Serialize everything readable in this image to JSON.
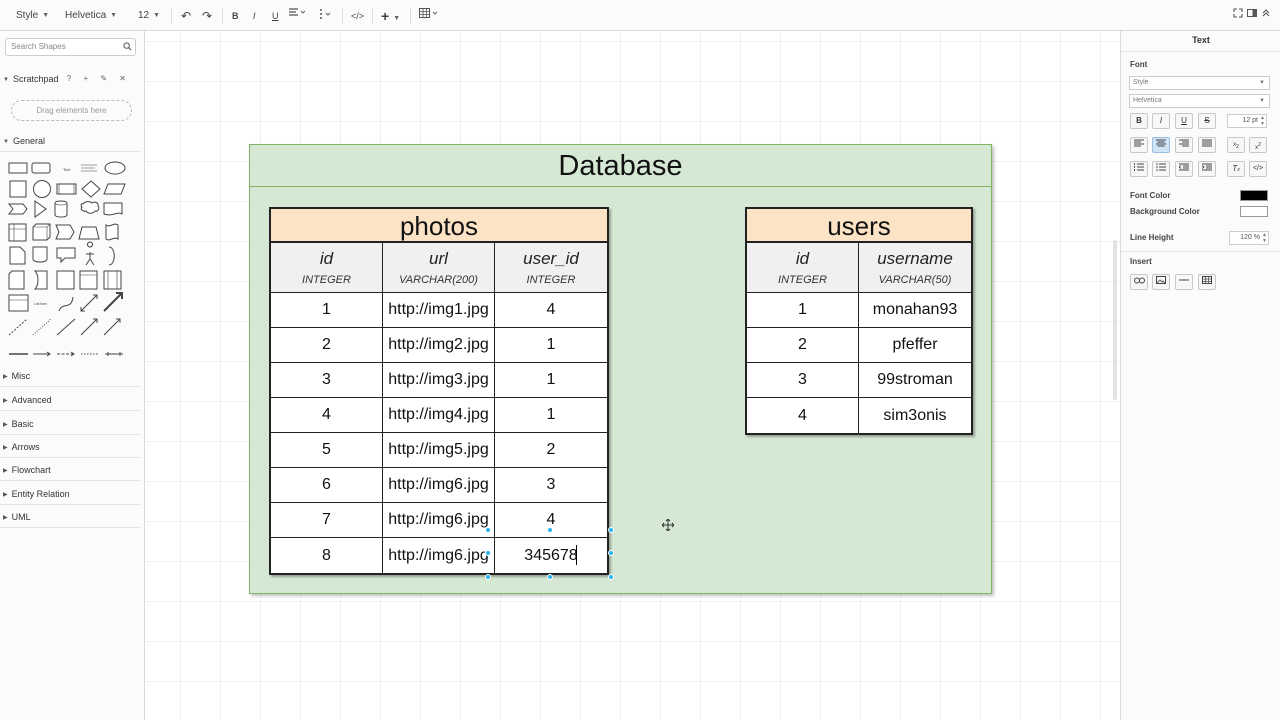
{
  "toolbar": {
    "style_label": "Style",
    "font_label": "Helvetica",
    "size_label": "12"
  },
  "sidebar": {
    "search_placeholder": "Search Shapes",
    "scratchpad_label": "Scratchpad",
    "scratchpad_tools": "? + ✎ ✕",
    "drop_hint": "Drag elements here",
    "general_label": "General",
    "sections": [
      "Misc",
      "Advanced",
      "Basic",
      "Arrows",
      "Flowchart",
      "Entity Relation",
      "UML"
    ]
  },
  "diagram": {
    "title": "Database",
    "photos": {
      "name": "photos",
      "columns": [
        {
          "name": "id",
          "type": "INTEGER"
        },
        {
          "name": "url",
          "type": "VARCHAR(200)"
        },
        {
          "name": "user_id",
          "type": "INTEGER"
        }
      ],
      "rows": [
        [
          "1",
          "http://img1.jpg",
          "4"
        ],
        [
          "2",
          "http://img2.jpg",
          "1"
        ],
        [
          "3",
          "http://img3.jpg",
          "1"
        ],
        [
          "4",
          "http://img4.jpg",
          "1"
        ],
        [
          "5",
          "http://img5.jpg",
          "2"
        ],
        [
          "6",
          "http://img6.jpg",
          "3"
        ],
        [
          "7",
          "http://img6.jpg",
          "4"
        ],
        [
          "8",
          "http://img6.jpg",
          "345678"
        ]
      ]
    },
    "users": {
      "name": "users",
      "columns": [
        {
          "name": "id",
          "type": "INTEGER"
        },
        {
          "name": "username",
          "type": "VARCHAR(50)"
        }
      ],
      "rows": [
        [
          "1",
          "monahan93"
        ],
        [
          "2",
          "pfeffer"
        ],
        [
          "3",
          "99stroman"
        ],
        [
          "4",
          "sim3onis"
        ]
      ]
    }
  },
  "format_panel": {
    "tab_title": "Text",
    "font_heading": "Font",
    "style_select": "Style",
    "font_select": "Helvetica",
    "font_size": "12 pt",
    "font_color_label": "Font Color",
    "background_color_label": "Background Color",
    "line_height_label": "Line Height",
    "line_height_value": "120 %",
    "insert_label": "Insert",
    "font_color": "#000000",
    "background_color": "#ffffff",
    "accent_color": "#29b6f2"
  }
}
